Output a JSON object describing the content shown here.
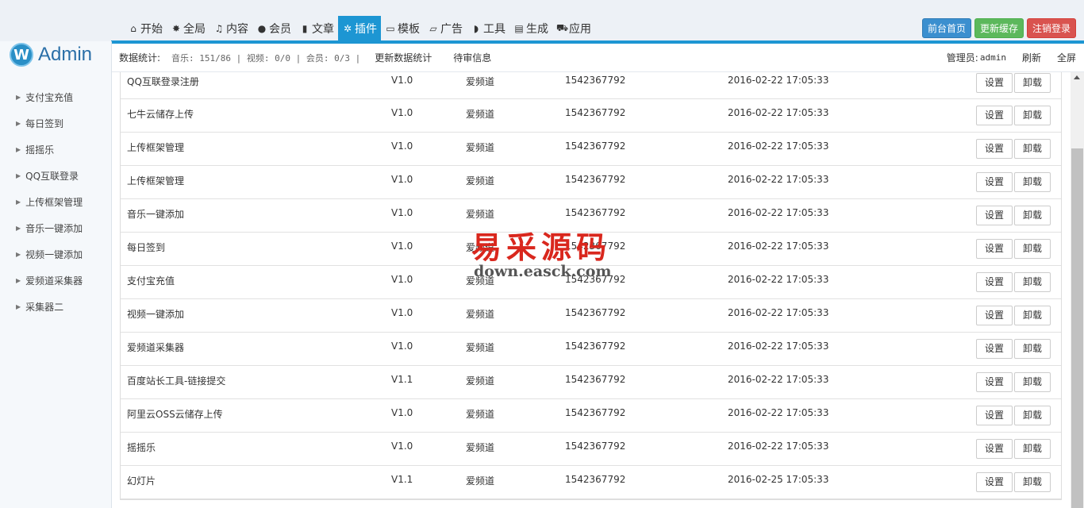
{
  "logo": {
    "mark": "W",
    "text": "Admin"
  },
  "nav": [
    {
      "label": "开始",
      "icon": "home-icon",
      "glyph": "⌂"
    },
    {
      "label": "全局",
      "icon": "gear-icon",
      "glyph": "✸"
    },
    {
      "label": "内容",
      "icon": "music-icon",
      "glyph": "♫"
    },
    {
      "label": "会员",
      "icon": "user-icon",
      "glyph": "●"
    },
    {
      "label": "文章",
      "icon": "file-icon",
      "glyph": "▮"
    },
    {
      "label": "插件",
      "icon": "plugin-gears-icon",
      "glyph": "✲",
      "active": true
    },
    {
      "label": "模板",
      "icon": "monitor-icon",
      "glyph": "▭"
    },
    {
      "label": "广告",
      "icon": "laptop-icon",
      "glyph": "▱"
    },
    {
      "label": "工具",
      "icon": "shield-icon",
      "glyph": "◗"
    },
    {
      "label": "生成",
      "icon": "folder-icon",
      "glyph": "▤"
    },
    {
      "label": "应用",
      "icon": "cart-icon",
      "glyph": "⛟"
    }
  ],
  "top_buttons": {
    "home": "前台首页",
    "cache": "更新缓存",
    "logout": "注销登录"
  },
  "infobar": {
    "label": "数据统计:",
    "stats": "音乐: 151/86 | 视频: 0/0 | 会员: 0/3 |",
    "update_stats": "更新数据统计",
    "pending": "待审信息",
    "admin_label": "管理员:",
    "admin_name": "admin",
    "refresh": "刷新",
    "fullscreen": "全屏"
  },
  "sidebar": {
    "items": [
      "支付宝充值",
      "每日签到",
      "摇摇乐",
      "QQ互联登录",
      "上传框架管理",
      "音乐一键添加",
      "视频一键添加",
      "爱频道采集器",
      "采集器二"
    ]
  },
  "table": {
    "settings_label": "设置",
    "uninstall_label": "卸载",
    "rows": [
      {
        "name": "QQ互联登录注册",
        "version": "V1.0",
        "author": "爱频道",
        "qq": "1542367792",
        "date": "2016-02-22 17:05:33"
      },
      {
        "name": "七牛云储存上传",
        "version": "V1.0",
        "author": "爱频道",
        "qq": "1542367792",
        "date": "2016-02-22 17:05:33"
      },
      {
        "name": "上传框架管理",
        "version": "V1.0",
        "author": "爱频道",
        "qq": "1542367792",
        "date": "2016-02-22 17:05:33"
      },
      {
        "name": "上传框架管理",
        "version": "V1.0",
        "author": "爱频道",
        "qq": "1542367792",
        "date": "2016-02-22 17:05:33"
      },
      {
        "name": "音乐一键添加",
        "version": "V1.0",
        "author": "爱频道",
        "qq": "1542367792",
        "date": "2016-02-22 17:05:33"
      },
      {
        "name": "每日签到",
        "version": "V1.0",
        "author": "爱频道",
        "qq": "1542367792",
        "date": "2016-02-22 17:05:33"
      },
      {
        "name": "支付宝充值",
        "version": "V1.0",
        "author": "爱频道",
        "qq": "1542367792",
        "date": "2016-02-22 17:05:33"
      },
      {
        "name": "视频一键添加",
        "version": "V1.0",
        "author": "爱频道",
        "qq": "1542367792",
        "date": "2016-02-22 17:05:33"
      },
      {
        "name": "爱频道采集器",
        "version": "V1.0",
        "author": "爱频道",
        "qq": "1542367792",
        "date": "2016-02-22 17:05:33"
      },
      {
        "name": "百度站长工具-链接提交",
        "version": "V1.1",
        "author": "爱频道",
        "qq": "1542367792",
        "date": "2016-02-22 17:05:33"
      },
      {
        "name": "阿里云OSS云储存上传",
        "version": "V1.0",
        "author": "爱频道",
        "qq": "1542367792",
        "date": "2016-02-22 17:05:33"
      },
      {
        "name": "摇摇乐",
        "version": "V1.0",
        "author": "爱频道",
        "qq": "1542367792",
        "date": "2016-02-22 17:05:33"
      },
      {
        "name": "幻灯片",
        "version": "V1.1",
        "author": "爱频道",
        "qq": "1542367792",
        "date": "2016-02-25 17:05:33"
      }
    ]
  },
  "watermark": {
    "cn": "易采源码",
    "url": "down.easck.com"
  },
  "colors": {
    "accent": "#1d96d3",
    "blue_btn": "#3b8fcf",
    "green_btn": "#5cb85c",
    "red_btn": "#d9534f",
    "watermark": "#d9271d"
  }
}
